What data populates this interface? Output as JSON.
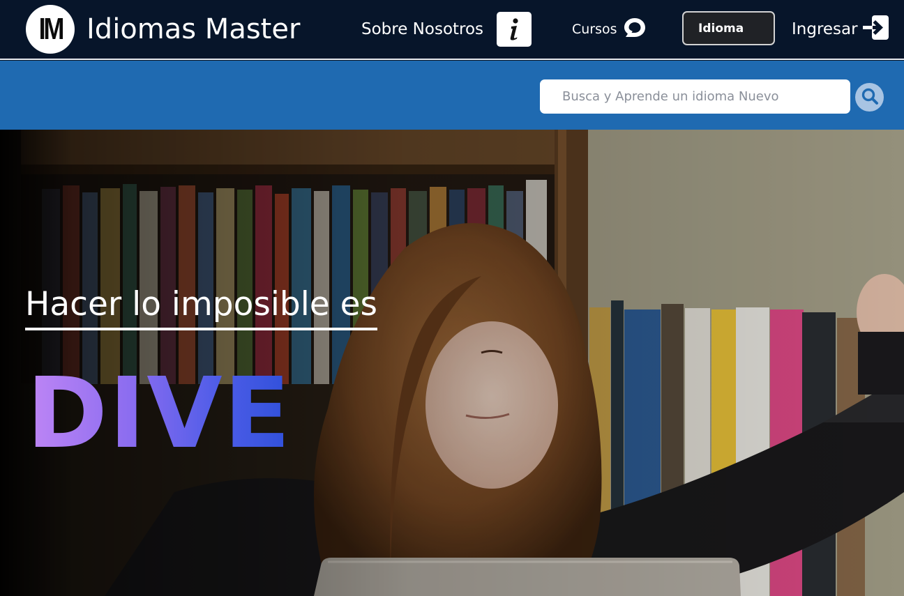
{
  "navbar": {
    "logo_text": "IM",
    "brand_name": "Idiomas Master",
    "about_label": "Sobre Nosotros",
    "about_icon": "info-icon",
    "cursos_label": "Cursos",
    "cursos_icon": "chat-bubble-icon",
    "idioma_label": "Idioma",
    "login_label": "Ingresar",
    "login_icon": "sign-in-arrow-icon"
  },
  "search": {
    "placeholder": "Busca y Aprende un idioma Nuevo",
    "button_icon": "search-icon"
  },
  "hero": {
    "tagline": "Hacer lo imposible es",
    "highlight_word": "DIVE",
    "image": "girl-celebrating-at-laptop-in-front-of-bookshelf"
  },
  "colors": {
    "navbar_bg": "#07152a",
    "search_band_bg": "#1f6ab1",
    "idioma_button_bg": "#202226",
    "gradient_start": "#bf86f5",
    "gradient_end": "#2f50da"
  }
}
